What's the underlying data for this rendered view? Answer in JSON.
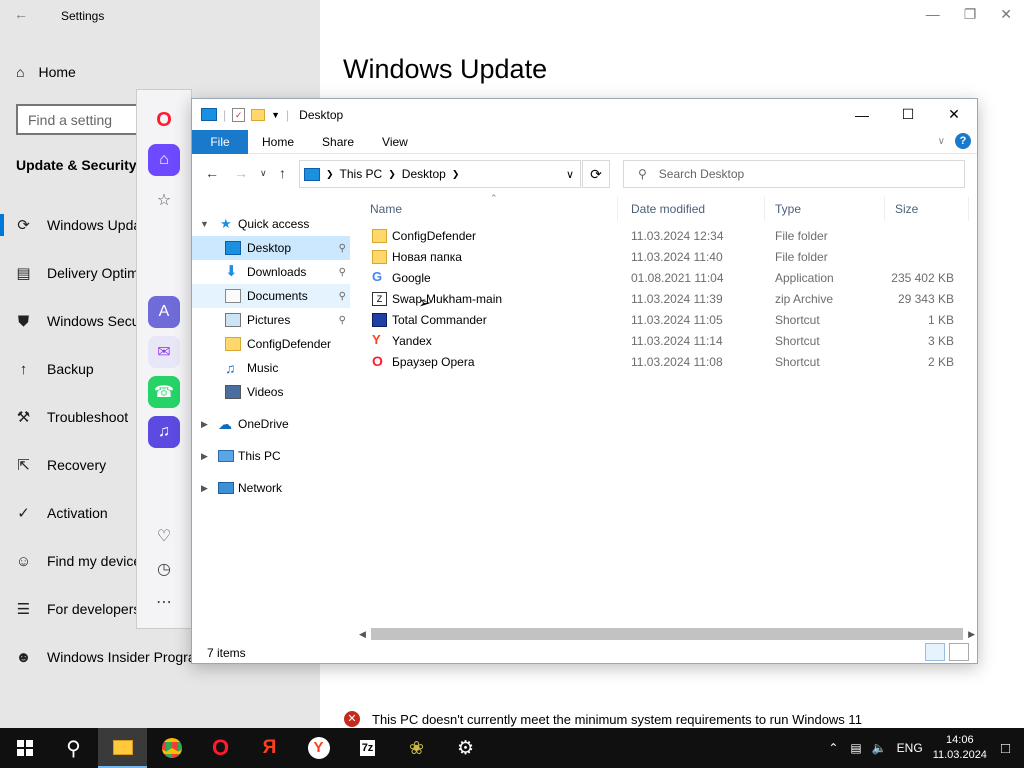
{
  "settings": {
    "title": "Settings",
    "home": "Home",
    "search_placeholder": "Find a setting",
    "section": "Update & Security",
    "heading": "Windows Update",
    "nav": [
      {
        "label": "Windows Update",
        "icon": "sync-icon"
      },
      {
        "label": "Delivery Optimization",
        "icon": "delivery-icon"
      },
      {
        "label": "Windows Security",
        "icon": "shield-icon"
      },
      {
        "label": "Backup",
        "icon": "backup-icon"
      },
      {
        "label": "Troubleshoot",
        "icon": "wrench-icon"
      },
      {
        "label": "Recovery",
        "icon": "recovery-icon"
      },
      {
        "label": "Activation",
        "icon": "check-circle-icon"
      },
      {
        "label": "Find my device",
        "icon": "person-pin-icon"
      },
      {
        "label": "For developers",
        "icon": "developer-icon"
      },
      {
        "label": "Windows Insider Program",
        "icon": "insider-icon"
      }
    ],
    "warning": "This PC doesn't currently meet the minimum system requirements to run Windows 11"
  },
  "explorer": {
    "title": "Desktop",
    "ribbon_tabs": [
      "File",
      "Home",
      "Share",
      "View"
    ],
    "breadcrumb": [
      "This PC",
      "Desktop"
    ],
    "search_placeholder": "Search Desktop",
    "columns": [
      "Name",
      "Date modified",
      "Type",
      "Size"
    ],
    "nav": {
      "quick_access": "Quick access",
      "quick_items": [
        {
          "label": "Desktop",
          "pinned": true
        },
        {
          "label": "Downloads",
          "pinned": true
        },
        {
          "label": "Documents",
          "pinned": true
        },
        {
          "label": "Pictures",
          "pinned": true
        },
        {
          "label": "ConfigDefender",
          "pinned": false
        },
        {
          "label": "Music",
          "pinned": false
        },
        {
          "label": "Videos",
          "pinned": false
        }
      ],
      "onedrive": "OneDrive",
      "this_pc": "This PC",
      "network": "Network"
    },
    "files": [
      {
        "name": "ConfigDefender",
        "date": "11.03.2024 12:34",
        "type": "File folder",
        "size": "",
        "icon": "folder-icon"
      },
      {
        "name": "Новая папка",
        "date": "11.03.2024 11:40",
        "type": "File folder",
        "size": "",
        "icon": "folder-icon"
      },
      {
        "name": "Google",
        "date": "01.08.2021 11:04",
        "type": "Application",
        "size": "235 402 KB",
        "icon": "google-icon"
      },
      {
        "name": "Swap-Mukham-main",
        "date": "11.03.2024 11:39",
        "type": "zip Archive",
        "size": "29 343 KB",
        "icon": "zip-icon"
      },
      {
        "name": "Total Commander",
        "date": "11.03.2024 11:05",
        "type": "Shortcut",
        "size": "1 KB",
        "icon": "floppy-icon"
      },
      {
        "name": "Yandex",
        "date": "11.03.2024 11:14",
        "type": "Shortcut",
        "size": "3 KB",
        "icon": "yandex-icon"
      },
      {
        "name": "Браузер Opera",
        "date": "11.03.2024 11:08",
        "type": "Shortcut",
        "size": "2 KB",
        "icon": "opera-icon"
      }
    ],
    "status": "7 items"
  },
  "taskbar": {
    "lang": "ENG",
    "time": "14:06",
    "date": "11.03.2024"
  },
  "colors": {
    "accent": "#0078d7",
    "ribbon_file": "#1979ca",
    "selection": "#cce8ff",
    "taskbar": "#101010"
  }
}
